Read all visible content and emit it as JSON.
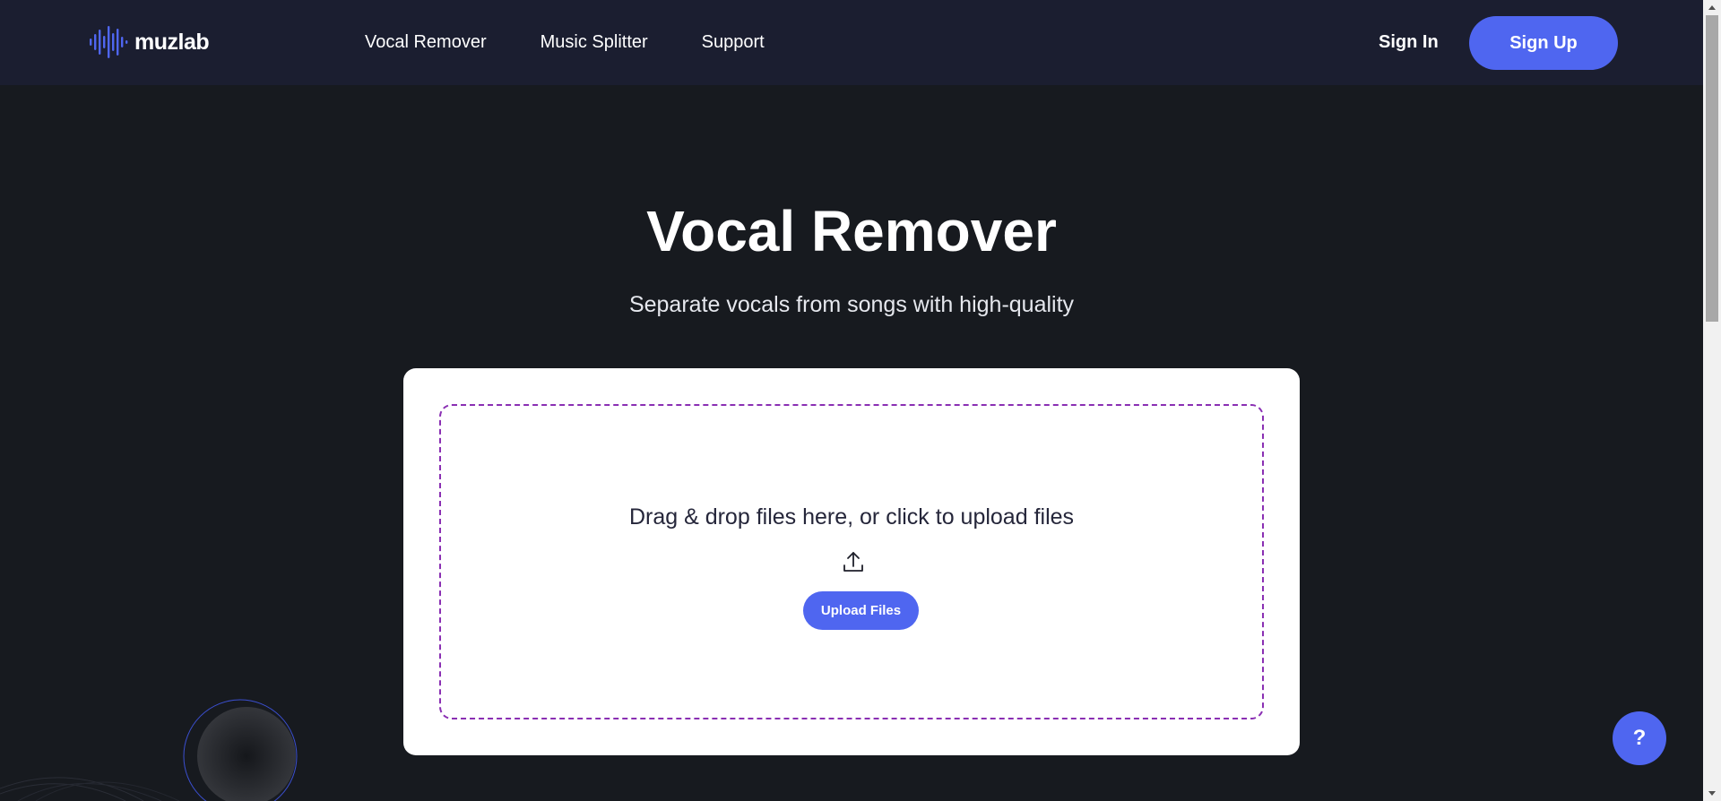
{
  "header": {
    "logo_text": "muzlab",
    "nav": [
      {
        "label": "Vocal Remover"
      },
      {
        "label": "Music Splitter"
      },
      {
        "label": "Support"
      }
    ],
    "sign_in": "Sign In",
    "sign_up": "Sign Up"
  },
  "hero": {
    "title": "Vocal Remover",
    "subtitle": "Separate vocals from songs with high-quality"
  },
  "upload": {
    "prompt": "Drag & drop files here, or click to upload files",
    "button": "Upload Files",
    "icon": "upload-icon"
  },
  "help": {
    "label": "?"
  },
  "colors": {
    "accent": "#4f66f0",
    "header_bg": "#1b1e30",
    "page_bg": "#171a1f",
    "dropzone_border": "#8a2fb3"
  }
}
